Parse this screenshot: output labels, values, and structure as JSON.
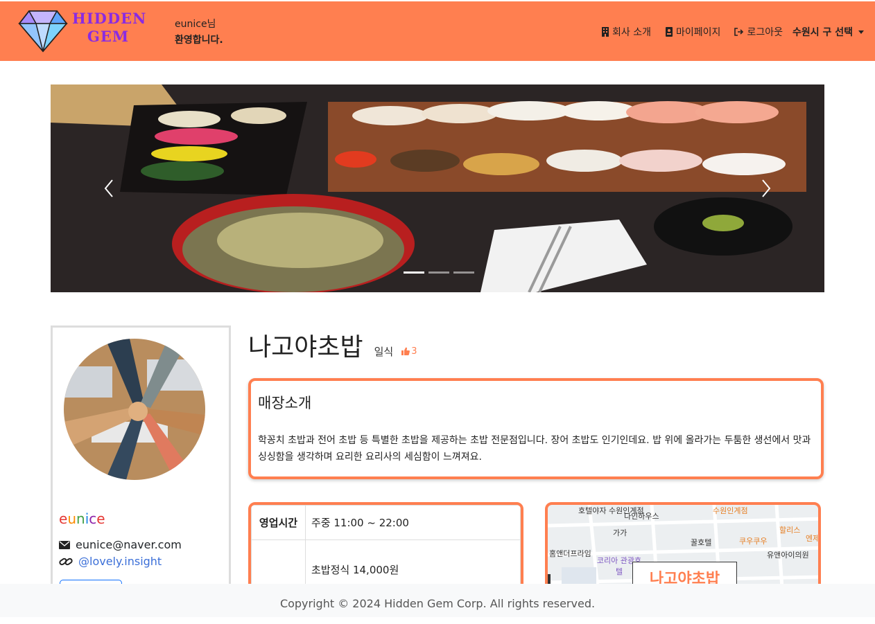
{
  "header": {
    "brand_line1": "HIDDEN",
    "brand_line2": "GEM",
    "welcome_user": "eunice님",
    "welcome_msg": "환영합니다.",
    "nav": {
      "company": "회사 소개",
      "mypage": "마이페이지",
      "logout": "로그아웃",
      "district_select": "수원시 구 선택"
    },
    "bg_color": "#ff7f50"
  },
  "carousel": {
    "slides": 3,
    "active_slide": 1,
    "prev_icon": "chevron-left-icon",
    "next_icon": "chevron-right-icon"
  },
  "profile": {
    "username": "eunice",
    "email": "eunice@naver.com",
    "instagram": "@lovely.insight"
  },
  "store": {
    "name": "나고야초밥",
    "category": "일식",
    "likes": "3",
    "intro_title": "매장소개",
    "intro_text": "학꽁치 초밥과 전어 초밥 등 특별한 초밥을 제공하는 초밥 전문점입니다. 장어 초밥도 인기인데요. 밥 위에 올라가는 두툼한 생선에서 맛과 싱싱함을 생각하며 요리한 요리사의 세심함이 느껴져요.",
    "info_rows": [
      {
        "label": "영업시간",
        "value": "주중 11:00 ~ 22:00"
      },
      {
        "label": "",
        "value": "초밥정식 14,000원"
      }
    ]
  },
  "map": {
    "labels": [
      "호텔야자 수원인계점",
      "다인하우스",
      "가가",
      "수원인계점",
      "꿀호텔",
      "쿠우쿠우",
      "할리스",
      "엔제",
      "홈앤더프라임",
      "코리아 관광호텔",
      "유앤아이의원"
    ],
    "marker_label": "나고야초밥"
  },
  "footer": {
    "copyright": "Copyright © 2024 Hidden Gem Corp. All rights reserved."
  }
}
